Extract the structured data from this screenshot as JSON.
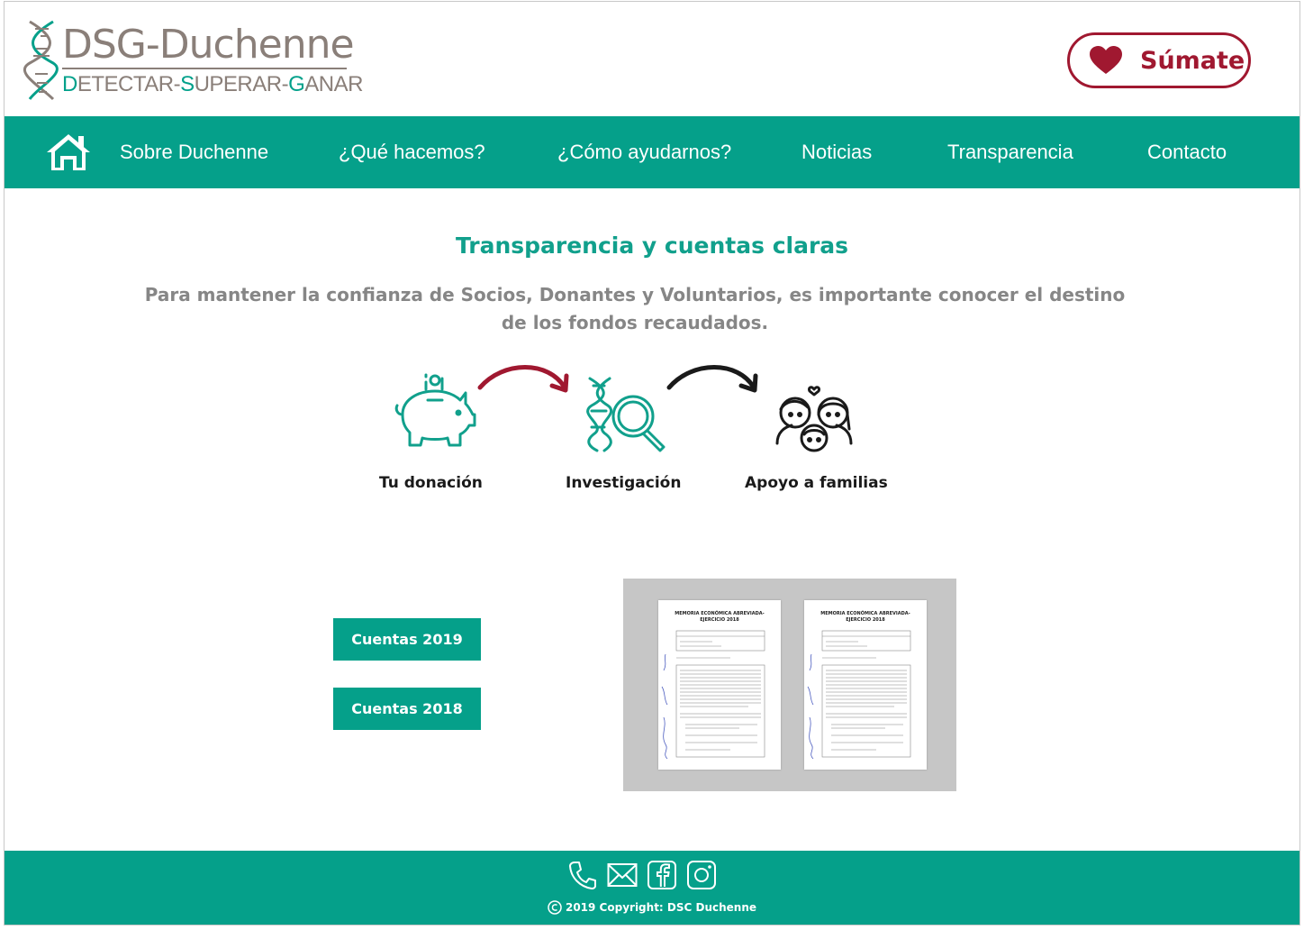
{
  "header": {
    "logo": {
      "title": "DSG-Duchenne",
      "tagline_parts": [
        {
          "text": "D",
          "accent": true
        },
        {
          "text": "ETECTAR-",
          "accent": false
        },
        {
          "text": "S",
          "accent": true
        },
        {
          "text": "UPERAR-",
          "accent": false
        },
        {
          "text": "G",
          "accent": true
        },
        {
          "text": "ANAR",
          "accent": false
        }
      ]
    },
    "cta": {
      "label": "Súmate",
      "icon": "heart-icon"
    }
  },
  "nav": {
    "home_icon": "home-icon",
    "items": [
      {
        "label": "Sobre Duchenne"
      },
      {
        "label": "¿Qué hacemos?"
      },
      {
        "label": "¿Cómo ayudarnos?"
      },
      {
        "label": "Noticias"
      },
      {
        "label": "Transparencia"
      },
      {
        "label": "Contacto"
      }
    ]
  },
  "main": {
    "title": "Transparencia y cuentas claras",
    "intro": "Para mantener la confianza de Socios, Donantes y Voluntarios, es importante conocer el destino de los fondos recaudados.",
    "flow": [
      {
        "label": "Tu donación",
        "icon": "piggy-bank-icon"
      },
      {
        "label": "Investigación",
        "icon": "dna-magnifier-icon"
      },
      {
        "label": "Apoyo a familias",
        "icon": "family-icon"
      }
    ],
    "buttons": [
      {
        "label": "Cuentas 2019"
      },
      {
        "label": "Cuentas 2018"
      }
    ],
    "documents": [
      {
        "title": "MEMORIA ECONÓMICA ABREVIADA-EJERCICIO 2018"
      },
      {
        "title": "MEMORIA ECONÓMICA ABREVIADA-EJERCICIO 2018"
      }
    ]
  },
  "footer": {
    "icons": [
      "phone-icon",
      "mail-icon",
      "facebook-icon",
      "instagram-icon"
    ],
    "copyright": "2019 Copyright: DSC Duchenne"
  },
  "colors": {
    "brand_teal": "#05a08a",
    "brand_red": "#a01830",
    "logo_gray": "#8a7f79",
    "text_gray": "#868686"
  }
}
